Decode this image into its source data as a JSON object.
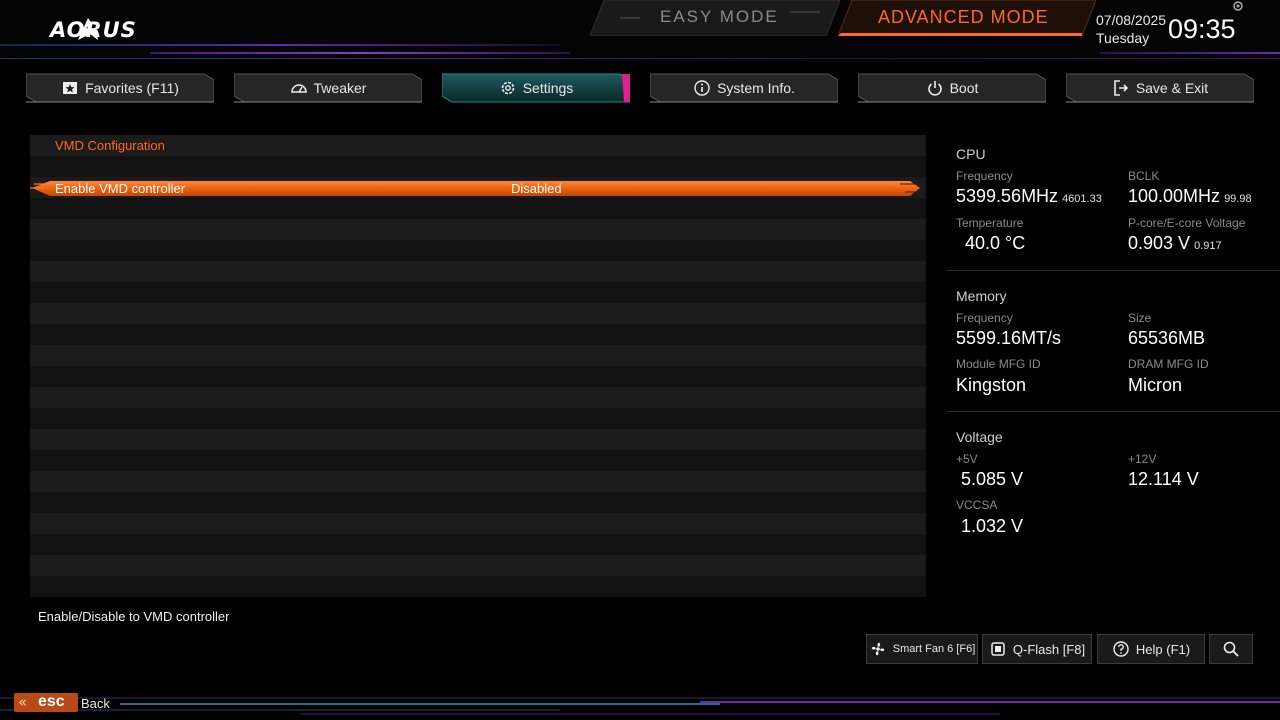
{
  "header": {
    "brand": "AORUS",
    "easy_mode_label": "EASY MODE",
    "advanced_mode_label": "ADVANCED MODE",
    "date": "07/08/2025",
    "day": "Tuesday",
    "time": "09:35"
  },
  "tabs": [
    {
      "label": "Favorites (F11)",
      "icon": "star-icon"
    },
    {
      "label": "Tweaker",
      "icon": "speedometer-icon"
    },
    {
      "label": "Settings",
      "icon": "gear-icon",
      "active": true
    },
    {
      "label": "System Info.",
      "icon": "info-icon"
    },
    {
      "label": "Boot",
      "icon": "power-icon"
    },
    {
      "label": "Save & Exit",
      "icon": "exit-icon"
    }
  ],
  "main": {
    "section_title": "VMD Configuration",
    "selected_item": {
      "label": "Enable VMD controller",
      "value": "Disabled"
    },
    "help_text": "Enable/Disable to VMD controller"
  },
  "info": {
    "cpu": {
      "heading": "CPU",
      "frequency_label": "Frequency",
      "frequency_value": "5399.56MHz",
      "frequency_sub": "4601.33",
      "bclk_label": "BCLK",
      "bclk_value": "100.00MHz",
      "bclk_sub": "99.98",
      "temp_label": "Temperature",
      "temp_value": "40.0 °C",
      "voltage_label": "P-core/E-core Voltage",
      "voltage_value": "0.903 V",
      "voltage_sub": "0.917"
    },
    "memory": {
      "heading": "Memory",
      "frequency_label": "Frequency",
      "frequency_value": "5599.16MT/s",
      "size_label": "Size",
      "size_value": "65536MB",
      "module_label": "Module MFG ID",
      "module_value": "Kingston",
      "dram_label": "DRAM MFG ID",
      "dram_value": "Micron"
    },
    "voltage": {
      "heading": "Voltage",
      "v5_label": "+5V",
      "v5_value": "5.085 V",
      "v12_label": "+12V",
      "v12_value": "12.114 V",
      "vccsa_label": "VCCSA",
      "vccsa_value": "1.032 V"
    }
  },
  "bottom": {
    "smart_fan_label": "Smart Fan 6 [F6]",
    "qflash_label": "Q-Flash [F8]",
    "help_label": "Help (F1)",
    "esc_label": "esc",
    "back_label": "Back"
  },
  "colors": {
    "accent_orange": "#ff6a1a",
    "active_tab_teal": "#1f6f72",
    "active_tab_magenta": "#e0208c",
    "background": "#000000"
  }
}
